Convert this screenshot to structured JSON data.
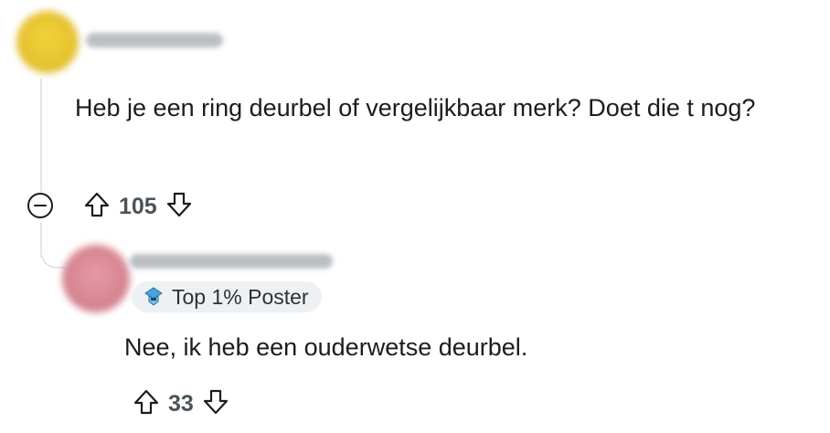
{
  "comment": {
    "author": "",
    "body": "Heb je een ring deurbel of vergelijkbaar merk? Doet die t nog?",
    "score": "105",
    "avatar_color": "#e6c42e"
  },
  "reply": {
    "author": "",
    "flair_label": "Top 1% Poster",
    "body": "Nee, ik heb een ouderwetse deurbel.",
    "score": "33",
    "avatar_color": "#d98a98"
  },
  "icons": {
    "upvote": "upvote-arrow-icon",
    "downvote": "downvote-arrow-icon",
    "collapse": "collapse-minus-icon",
    "flair": "top-poster-badge-icon"
  }
}
